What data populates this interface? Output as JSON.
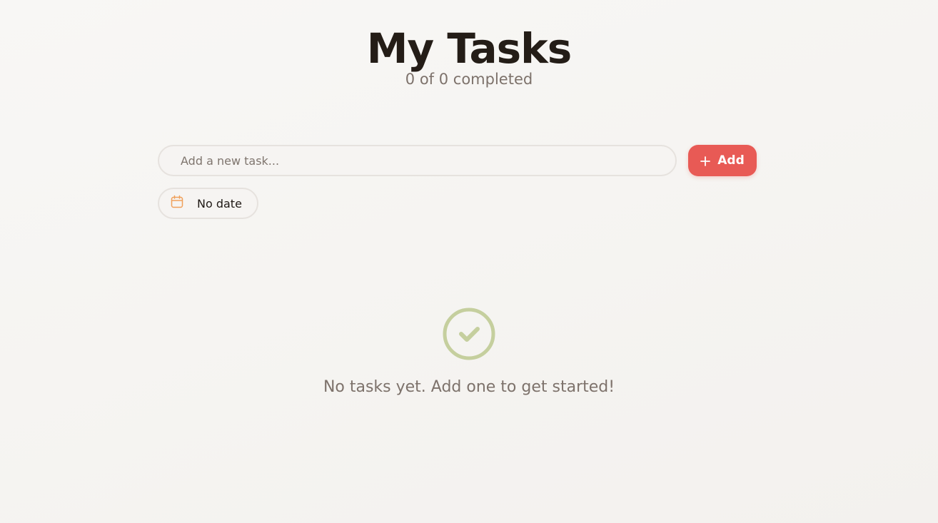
{
  "header": {
    "title": "My Tasks",
    "progress_text": "0 of 0 completed",
    "completed_count": 0,
    "total_count": 0
  },
  "add_task": {
    "input_value": "",
    "input_placeholder": "Add a new task...",
    "add_label": "Add",
    "add_icon": "plus-icon",
    "accent_color": "#e85a55"
  },
  "date_picker": {
    "label": "No date",
    "icon": "calendar-icon",
    "icon_color": "#f0a05a"
  },
  "empty_state": {
    "icon": "check-circle-icon",
    "icon_color": "#c5cf9e",
    "message": "No tasks yet. Add one to get started!"
  }
}
